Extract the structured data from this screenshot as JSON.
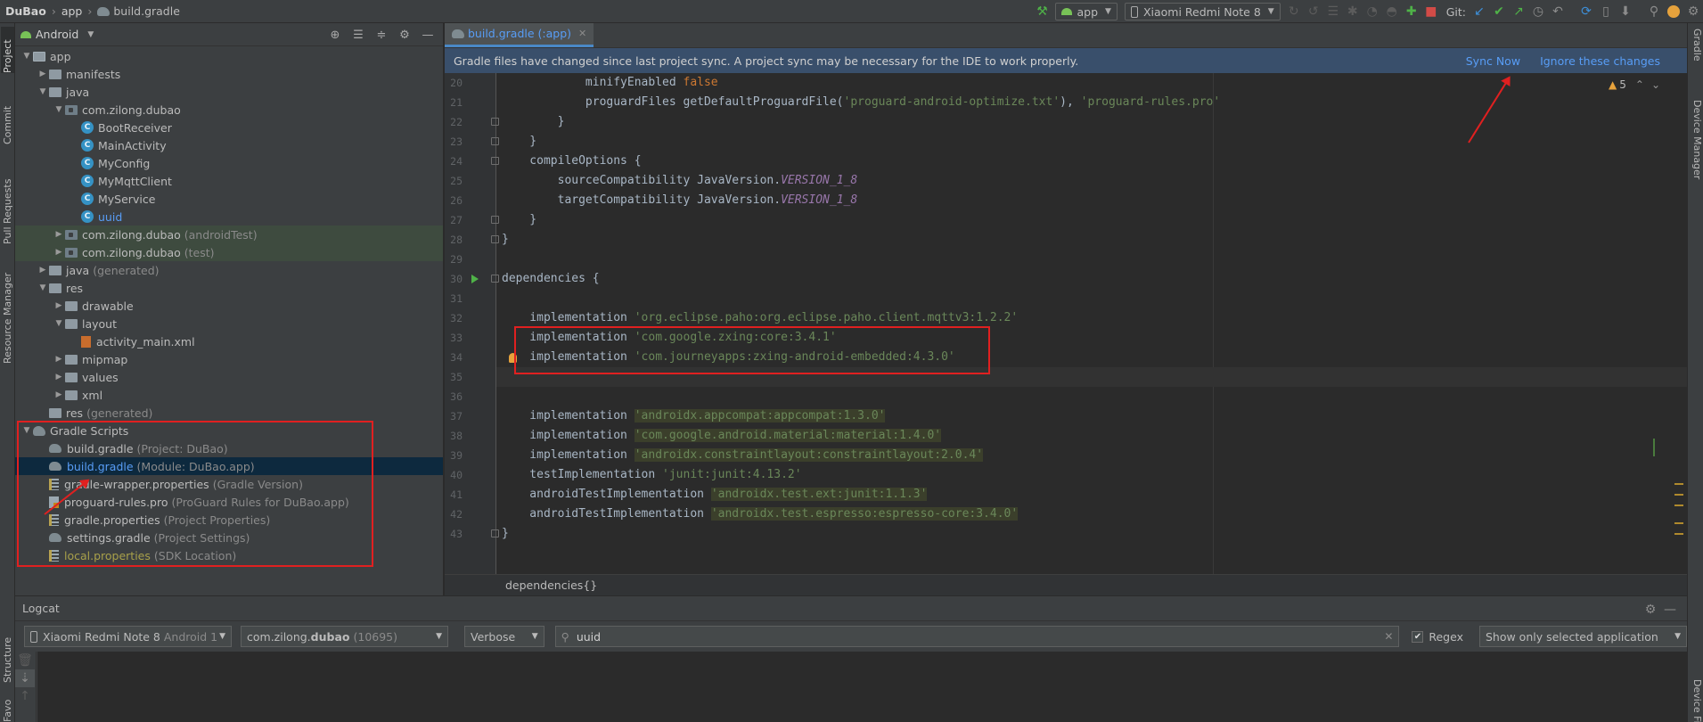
{
  "nav": {
    "project": "DuBao",
    "module": "app",
    "file": "build.gradle"
  },
  "toolbar": {
    "run_config": "app",
    "device": "Xiaomi Redmi Note 8",
    "git_label": "Git:"
  },
  "left_strip": {
    "tabs": [
      "Project",
      "Commit",
      "Pull Requests",
      "Resource Manager",
      "Structure",
      "Favorites"
    ]
  },
  "right_strip": {
    "tabs": [
      "Gradle",
      "Device Manager",
      "Device File Explorer"
    ]
  },
  "project_panel": {
    "view_mode": "Android",
    "tree": [
      {
        "label": "app",
        "suffix": "",
        "depth": 0,
        "arrow": "open",
        "icon": "folder-app"
      },
      {
        "label": "manifests",
        "suffix": "",
        "depth": 1,
        "arrow": "closed",
        "icon": "folder"
      },
      {
        "label": "java",
        "suffix": "",
        "depth": 1,
        "arrow": "open",
        "icon": "folder"
      },
      {
        "label": "com.zilong.dubao",
        "suffix": "",
        "depth": 2,
        "arrow": "open",
        "icon": "package"
      },
      {
        "label": "BootReceiver",
        "suffix": "",
        "depth": 3,
        "arrow": "",
        "icon": "class"
      },
      {
        "label": "MainActivity",
        "suffix": "",
        "depth": 3,
        "arrow": "",
        "icon": "class"
      },
      {
        "label": "MyConfig",
        "suffix": "",
        "depth": 3,
        "arrow": "",
        "icon": "class"
      },
      {
        "label": "MyMqttClient",
        "suffix": "",
        "depth": 3,
        "arrow": "",
        "icon": "class"
      },
      {
        "label": "MyService",
        "suffix": "",
        "depth": 3,
        "arrow": "",
        "icon": "class"
      },
      {
        "label": "uuid",
        "suffix": "",
        "depth": 3,
        "arrow": "",
        "icon": "class",
        "blue": true
      },
      {
        "label": "com.zilong.dubao",
        "suffix": "(androidTest)",
        "depth": 2,
        "arrow": "closed",
        "icon": "package",
        "hl": true
      },
      {
        "label": "com.zilong.dubao",
        "suffix": "(test)",
        "depth": 2,
        "arrow": "closed",
        "icon": "package",
        "hl": true
      },
      {
        "label": "java",
        "suffix": "(generated)",
        "depth": 1,
        "arrow": "closed",
        "icon": "folder"
      },
      {
        "label": "res",
        "suffix": "",
        "depth": 1,
        "arrow": "open",
        "icon": "folder"
      },
      {
        "label": "drawable",
        "suffix": "",
        "depth": 2,
        "arrow": "closed",
        "icon": "folder"
      },
      {
        "label": "layout",
        "suffix": "",
        "depth": 2,
        "arrow": "open",
        "icon": "folder"
      },
      {
        "label": "activity_main.xml",
        "suffix": "",
        "depth": 3,
        "arrow": "",
        "icon": "xml"
      },
      {
        "label": "mipmap",
        "suffix": "",
        "depth": 2,
        "arrow": "closed",
        "icon": "folder"
      },
      {
        "label": "values",
        "suffix": "",
        "depth": 2,
        "arrow": "closed",
        "icon": "folder"
      },
      {
        "label": "xml",
        "suffix": "",
        "depth": 2,
        "arrow": "closed",
        "icon": "folder"
      },
      {
        "label": "res",
        "suffix": "(generated)",
        "depth": 1,
        "arrow": "",
        "icon": "folder"
      },
      {
        "label": "Gradle Scripts",
        "suffix": "",
        "depth": 0,
        "arrow": "open",
        "icon": "gradle-scripts"
      },
      {
        "label": "build.gradle",
        "suffix": "(Project: DuBao)",
        "depth": 1,
        "arrow": "",
        "icon": "gradle"
      },
      {
        "label": "build.gradle",
        "suffix": "(Module: DuBao.app)",
        "depth": 1,
        "arrow": "",
        "icon": "gradle",
        "selected": true,
        "blue": true
      },
      {
        "label": "gradle-wrapper.properties",
        "suffix": "(Gradle Version)",
        "depth": 1,
        "arrow": "",
        "icon": "properties"
      },
      {
        "label": "proguard-rules.pro",
        "suffix": "(ProGuard Rules for DuBao.app)",
        "depth": 1,
        "arrow": "",
        "icon": "file"
      },
      {
        "label": "gradle.properties",
        "suffix": "(Project Properties)",
        "depth": 1,
        "arrow": "",
        "icon": "properties"
      },
      {
        "label": "settings.gradle",
        "suffix": "(Project Settings)",
        "depth": 1,
        "arrow": "",
        "icon": "gradle"
      },
      {
        "label": "local.properties",
        "suffix": "(SDK Location)",
        "depth": 1,
        "arrow": "",
        "icon": "properties",
        "yellow": true
      }
    ]
  },
  "editor": {
    "tab_label": "build.gradle (:app)",
    "banner_text": "Gradle files have changed since last project sync. A project sync may be necessary for the IDE to work properly.",
    "sync_now": "Sync Now",
    "ignore_changes": "Ignore these changes",
    "warning_count": "5",
    "breadcrumb": "dependencies{}",
    "lines": [
      {
        "n": "20",
        "code": [
          {
            "t": "            minifyEnabled ",
            "c": ""
          },
          {
            "t": "false",
            "c": "kw"
          }
        ]
      },
      {
        "n": "21",
        "code": [
          {
            "t": "            proguardFiles getDefaultProguardFile(",
            "c": ""
          },
          {
            "t": "'proguard-android-optimize.txt'",
            "c": "str"
          },
          {
            "t": "), ",
            "c": ""
          },
          {
            "t": "'proguard-rules.pro'",
            "c": "str"
          }
        ]
      },
      {
        "n": "22",
        "code": [
          {
            "t": "        }",
            "c": ""
          }
        ]
      },
      {
        "n": "23",
        "code": [
          {
            "t": "    }",
            "c": ""
          }
        ]
      },
      {
        "n": "24",
        "code": [
          {
            "t": "    compileOptions {",
            "c": ""
          }
        ]
      },
      {
        "n": "25",
        "code": [
          {
            "t": "        sourceCompatibility JavaVersion.",
            "c": ""
          },
          {
            "t": "VERSION_1_8",
            "c": "const"
          }
        ]
      },
      {
        "n": "26",
        "code": [
          {
            "t": "        targetCompatibility JavaVersion.",
            "c": ""
          },
          {
            "t": "VERSION_1_8",
            "c": "const"
          }
        ]
      },
      {
        "n": "27",
        "code": [
          {
            "t": "    }",
            "c": ""
          }
        ]
      },
      {
        "n": "28",
        "code": [
          {
            "t": "}",
            "c": ""
          }
        ]
      },
      {
        "n": "29",
        "code": []
      },
      {
        "n": "30",
        "code": [
          {
            "t": "dependencies {",
            "c": ""
          }
        ]
      },
      {
        "n": "31",
        "code": []
      },
      {
        "n": "32",
        "code": [
          {
            "t": "    implementation ",
            "c": ""
          },
          {
            "t": "'org.eclipse.paho:org.eclipse.paho.client.mqttv3:1.2.2'",
            "c": "str"
          }
        ]
      },
      {
        "n": "33",
        "code": [
          {
            "t": "    implementation ",
            "c": ""
          },
          {
            "t": "'com.google.zxing:core:3.4.1'",
            "c": "str"
          }
        ]
      },
      {
        "n": "34",
        "code": [
          {
            "t": "    implementation ",
            "c": ""
          },
          {
            "t": "'com.journeyapps:zxing-android-embedded:4.3.0'",
            "c": "str"
          }
        ]
      },
      {
        "n": "35",
        "code": []
      },
      {
        "n": "36",
        "code": []
      },
      {
        "n": "37",
        "code": [
          {
            "t": "    implementation ",
            "c": ""
          },
          {
            "t": "'androidx.appcompat:appcompat:1.3.0'",
            "c": "strhl"
          }
        ]
      },
      {
        "n": "38",
        "code": [
          {
            "t": "    implementation ",
            "c": ""
          },
          {
            "t": "'com.google.android.material:material:1.4.0'",
            "c": "strhl"
          }
        ]
      },
      {
        "n": "39",
        "code": [
          {
            "t": "    implementation ",
            "c": ""
          },
          {
            "t": "'androidx.constraintlayout:constraintlayout:2.0.4'",
            "c": "strhl"
          }
        ]
      },
      {
        "n": "40",
        "code": [
          {
            "t": "    testImplementation ",
            "c": ""
          },
          {
            "t": "'junit:junit:4.13.2'",
            "c": "str"
          }
        ]
      },
      {
        "n": "41",
        "code": [
          {
            "t": "    androidTestImplementation ",
            "c": ""
          },
          {
            "t": "'androidx.test.ext:junit:1.1.3'",
            "c": "strhl"
          }
        ]
      },
      {
        "n": "42",
        "code": [
          {
            "t": "    androidTestImplementation ",
            "c": ""
          },
          {
            "t": "'androidx.test.espresso:espresso-core:3.4.0'",
            "c": "strhl"
          }
        ]
      },
      {
        "n": "43",
        "code": [
          {
            "t": "}",
            "c": ""
          }
        ]
      }
    ]
  },
  "logcat": {
    "title": "Logcat",
    "device": "Xiaomi Redmi Note 8",
    "device_suffix": "Android 1",
    "process_prefix": "com.zilong.",
    "process_bold": "dubao",
    "process_pid": "(10695)",
    "level": "Verbose",
    "search_value": "uuid",
    "regex_label": "Regex",
    "filter": "Show only selected application"
  },
  "colors": {
    "accent": "#589df6",
    "annotation_red": "#e02020"
  }
}
